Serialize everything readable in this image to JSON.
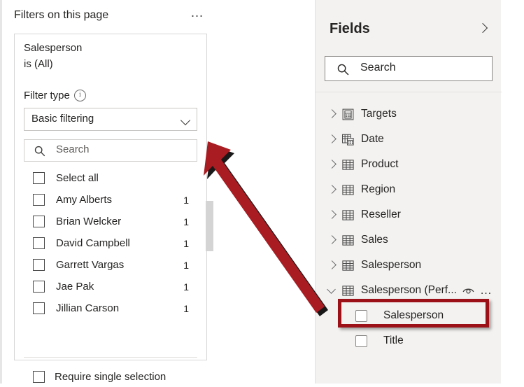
{
  "filter_pane": {
    "title": "Filters on this page",
    "more_icon": "ellipsis-icon",
    "more_label": "…",
    "card": {
      "field_name": "Salesperson",
      "condition": "is (All)",
      "filter_type_label": "Filter type",
      "info_icon": "info-icon",
      "filter_type_value": "Basic filtering",
      "search_placeholder": "Search",
      "search_value": "",
      "items": [
        {
          "label": "Select all",
          "count": "",
          "checked": false
        },
        {
          "label": "Amy Alberts",
          "count": "1",
          "checked": false
        },
        {
          "label": "Brian Welcker",
          "count": "1",
          "checked": false
        },
        {
          "label": "David Campbell",
          "count": "1",
          "checked": false
        },
        {
          "label": "Garrett Vargas",
          "count": "1",
          "checked": false
        },
        {
          "label": "Jae Pak",
          "count": "1",
          "checked": false
        },
        {
          "label": "Jillian Carson",
          "count": "1",
          "checked": false
        }
      ],
      "require_single_selection_label": "Require single selection",
      "require_single_selection_checked": false
    }
  },
  "fields_pane": {
    "title": "Fields",
    "collapse_icon": "chevron-right-icon",
    "search_placeholder": "Search",
    "search_value": "",
    "tables": [
      {
        "label": "Targets",
        "icon": "measure-table-icon",
        "expanded": false
      },
      {
        "label": "Date",
        "icon": "date-table-icon",
        "expanded": false
      },
      {
        "label": "Product",
        "icon": "table-icon",
        "expanded": false
      },
      {
        "label": "Region",
        "icon": "table-icon",
        "expanded": false
      },
      {
        "label": "Reseller",
        "icon": "table-icon",
        "expanded": false
      },
      {
        "label": "Sales",
        "icon": "table-icon",
        "expanded": false
      },
      {
        "label": "Salesperson",
        "icon": "table-icon",
        "expanded": false
      },
      {
        "label": "Salesperson (Perf...",
        "icon": "table-icon",
        "expanded": true,
        "eye_icon": "eye-icon",
        "more_icon": "ellipsis-icon",
        "more_label": "…"
      }
    ],
    "expanded_table_fields": [
      {
        "label": "Salesperson",
        "checked": false,
        "highlighted": true
      },
      {
        "label": "Title",
        "checked": false,
        "highlighted": false
      }
    ]
  },
  "annotations": {
    "highlight_color": "#9c1018",
    "arrow_color": "#a81c22",
    "arrow_shadow_color": "#000000",
    "arrow_from": "salesperson-field-row",
    "arrow_to": "filter-search-box"
  }
}
